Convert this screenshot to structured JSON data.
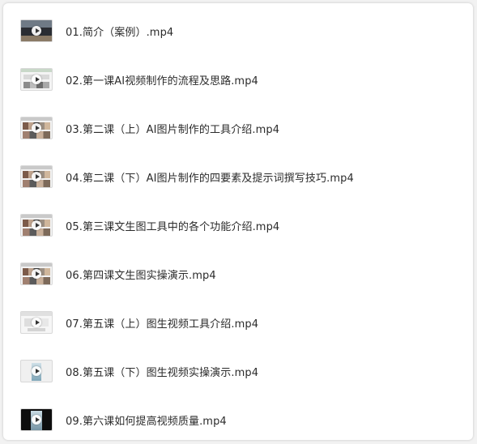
{
  "files": [
    {
      "name": "01.简介（案例）.mp4",
      "icon": "video-thumbnail-icon",
      "thumb": "t-dark"
    },
    {
      "name": "02.第一课AI视频制作的流程及思路.mp4",
      "icon": "video-thumbnail-icon",
      "thumb": "t-web"
    },
    {
      "name": "03.第二课（上）AI图片制作的工具介绍.mp4",
      "icon": "video-thumbnail-icon",
      "thumb": "t-grid"
    },
    {
      "name": "04.第二课（下）AI图片制作的四要素及提示词撰写技巧.mp4",
      "icon": "video-thumbnail-icon",
      "thumb": "t-grid"
    },
    {
      "name": "05.第三课文生图工具中的各个功能介绍.mp4",
      "icon": "video-thumbnail-icon",
      "thumb": "t-grid"
    },
    {
      "name": "06.第四课文生图实操演示.mp4",
      "icon": "video-thumbnail-icon",
      "thumb": "t-grid"
    },
    {
      "name": "07.第五课（上）图生视频工具介绍.mp4",
      "icon": "video-thumbnail-icon",
      "thumb": "t-light"
    },
    {
      "name": "08.第五课（下）图生视频实操演示.mp4",
      "icon": "video-thumbnail-icon",
      "thumb": "t-portrait"
    },
    {
      "name": "09.第六课如何提高视频质量.mp4",
      "icon": "video-thumbnail-icon",
      "thumb": "t-black"
    }
  ]
}
